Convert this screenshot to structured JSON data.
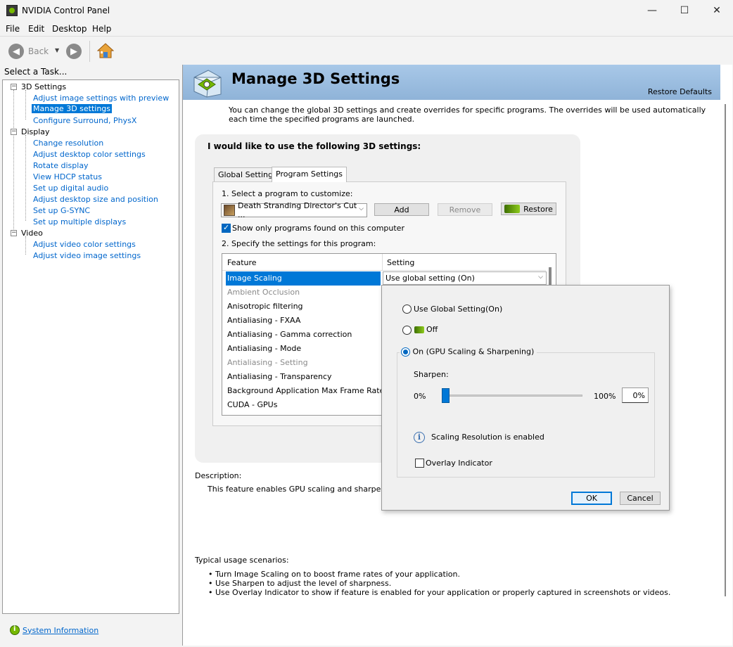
{
  "window": {
    "title": "NVIDIA Control Panel",
    "minimize": "—",
    "maximize": "☐",
    "close": "✕"
  },
  "menu": [
    "File",
    "Edit",
    "Desktop",
    "Help"
  ],
  "toolbar": {
    "back_label": "Back",
    "back_icon": "arrow-left-icon",
    "forward_icon": "arrow-right-icon",
    "home_icon": "home-icon"
  },
  "sidebar": {
    "header": "Select a Task...",
    "categories": [
      {
        "label": "3D Settings",
        "items": [
          "Adjust image settings with preview",
          "Manage 3D settings",
          "Configure Surround, PhysX"
        ]
      },
      {
        "label": "Display",
        "items": [
          "Change resolution",
          "Adjust desktop color settings",
          "Rotate display",
          "View HDCP status",
          "Set up digital audio",
          "Adjust desktop size and position",
          "Set up G-SYNC",
          "Set up multiple displays"
        ]
      },
      {
        "label": "Video",
        "items": [
          "Adjust video color settings",
          "Adjust video image settings"
        ]
      }
    ],
    "selected_item": "Manage 3D settings",
    "system_information": "System Information"
  },
  "main": {
    "title": "Manage 3D Settings",
    "restore_defaults": "Restore Defaults",
    "intro": "You can change the global 3D settings and create overrides for specific programs. The overrides will be used automatically each time the specified programs are launched.",
    "box_heading": "I would like to use the following 3D settings:",
    "tabs": [
      "Global Settings",
      "Program Settings"
    ],
    "active_tab": "Program Settings",
    "step1_label": "1. Select a program to customize:",
    "program_selected": "Death Stranding Director's Cut ...",
    "add_button": "Add",
    "remove_button": "Remove",
    "restore_button": "Restore",
    "show_only_label": "Show only programs found on this computer",
    "show_only_checked": true,
    "step2_label": "2. Specify the settings for this program:",
    "grid": {
      "col_feature": "Feature",
      "col_setting": "Setting",
      "selected_setting": "Use global setting (On)",
      "rows": [
        {
          "label": "Image Scaling",
          "state": "selected"
        },
        {
          "label": "Ambient Occlusion",
          "state": "disabled"
        },
        {
          "label": "Anisotropic filtering",
          "state": "normal"
        },
        {
          "label": "Antialiasing - FXAA",
          "state": "normal"
        },
        {
          "label": "Antialiasing - Gamma correction",
          "state": "normal"
        },
        {
          "label": "Antialiasing - Mode",
          "state": "normal"
        },
        {
          "label": "Antialiasing - Setting",
          "state": "disabled"
        },
        {
          "label": "Antialiasing - Transparency",
          "state": "normal"
        },
        {
          "label": "Background Application Max Frame Rate",
          "state": "normal"
        },
        {
          "label": "CUDA - GPUs",
          "state": "normal"
        }
      ]
    },
    "description_label": "Description:",
    "description_text": "This feature enables GPU scaling and sharpening for",
    "usage_label": "Typical usage scenarios:",
    "usage_items": [
      "Turn Image Scaling on to boost frame rates of your application.",
      "Use Sharpen to adjust the level of sharpness.",
      "Use Overlay Indicator to show if feature is enabled for your application or properly captured in screenshots or videos."
    ]
  },
  "popup": {
    "option_global": "Use Global Setting(On)",
    "option_off": "Off",
    "option_on": "On (GPU Scaling & Sharpening)",
    "selected_option": "On (GPU Scaling & Sharpening)",
    "sharpen_label": "Sharpen:",
    "min_label": "0%",
    "max_label": "100%",
    "sharpen_value": "0%",
    "sharpen_level": 0,
    "info_text": "Scaling Resolution is enabled",
    "overlay_label": "Overlay Indicator",
    "overlay_checked": false,
    "ok": "OK",
    "cancel": "Cancel"
  },
  "colors": {
    "accent": "#0078d7",
    "link": "#0066cc",
    "nvidia_green": "#76b900"
  }
}
